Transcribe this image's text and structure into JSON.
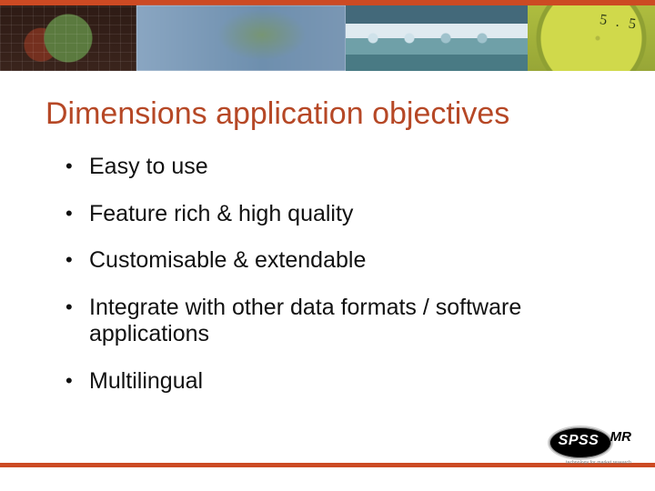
{
  "title": "Dimensions application objectives",
  "bullets": [
    "Easy to use",
    "Feature rich & high quality",
    "Customisable & extendable",
    "Integrate with other data formats / software applications",
    "Multilingual"
  ],
  "logo": {
    "brand": "SPSS",
    "suffix": "MR",
    "tagline": "technology for market research"
  },
  "colors": {
    "accent": "#cc4a23",
    "title": "#b64826"
  }
}
